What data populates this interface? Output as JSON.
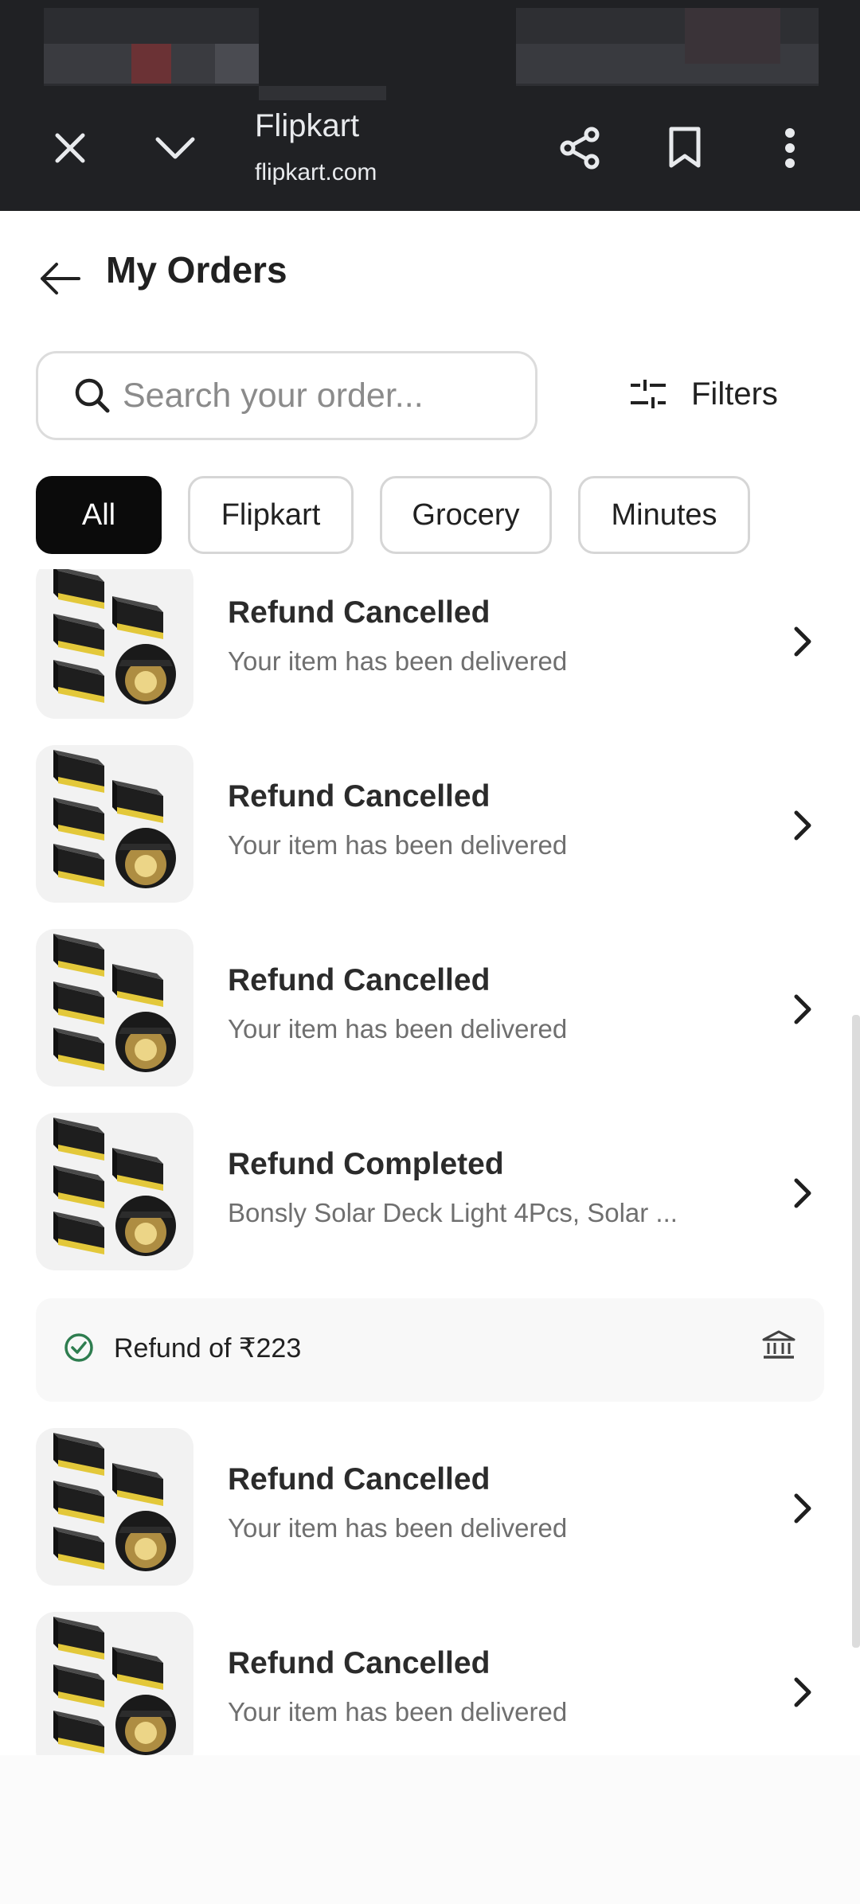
{
  "browser": {
    "site_title": "Flipkart",
    "site_url": "flipkart.com"
  },
  "header": {
    "title": "My Orders"
  },
  "search": {
    "placeholder": "Search your order..."
  },
  "filters": {
    "label": "Filters"
  },
  "chips": [
    {
      "label": "All",
      "active": true
    },
    {
      "label": "Flipkart",
      "active": false
    },
    {
      "label": "Grocery",
      "active": false
    },
    {
      "label": "Minutes",
      "active": false
    }
  ],
  "orders": [
    {
      "status": "Refund Cancelled",
      "subtitle": "Your item has been delivered"
    },
    {
      "status": "Refund Cancelled",
      "subtitle": "Your item has been delivered"
    },
    {
      "status": "Refund Cancelled",
      "subtitle": "Your item has been delivered"
    },
    {
      "status": "Refund Completed",
      "subtitle": "Bonsly Solar Deck Light 4Pcs, Solar ..."
    },
    {
      "status": "Refund Cancelled",
      "subtitle": "Your item has been delivered"
    },
    {
      "status": "Refund Cancelled",
      "subtitle": "Your item has been delivered"
    }
  ],
  "refund_info": {
    "text": "Refund of ₹223"
  },
  "colors": {
    "chrome_bar": "#202124",
    "active_chip": "#0b0b0b",
    "refund_check": "#2e7d4f"
  }
}
